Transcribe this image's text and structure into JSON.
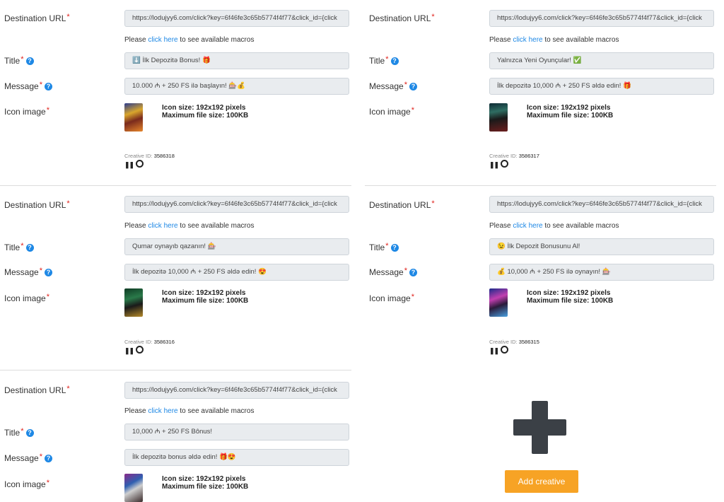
{
  "labels": {
    "destination_url": "Destination URL",
    "title": "Title",
    "message": "Message",
    "icon_image": "Icon image",
    "required_mark": "*",
    "help_glyph": "?"
  },
  "macros_hint": {
    "prefix": "Please",
    "link": "click here",
    "suffix": "to see available macros"
  },
  "icon_info": {
    "size": "Icon size: 192x192 pixels",
    "max": "Maximum file size: 100KB"
  },
  "creative_id_label": "Creative ID:",
  "creatives": [
    {
      "url": "https://lodujyy6.com/click?key=6f46fe3c65b5774f4f77&click_id={click",
      "title": "⬇️ İlk Depozitə Bonus! 🎁",
      "message": "10.000 ₼ + 250 FS ilə başlayın! 🎰💰",
      "creative_id": "3586318"
    },
    {
      "url": "https://lodujyy6.com/click?key=6f46fe3c65b5774f4f77&click_id={click",
      "title": "Yalnızca Yeni Oyunçular! ✅",
      "message": "İlk depozitə 10,000 ₼ + 250 FS əldə edin! 🎁",
      "creative_id": "3586317"
    },
    {
      "url": "https://lodujyy6.com/click?key=6f46fe3c65b5774f4f77&click_id={click",
      "title": "Qumar oynayıb qazanın! 🎰",
      "message": "İlk depozitə 10,000 ₼ + 250 FS əldə edin! 😍",
      "creative_id": "3586316"
    },
    {
      "url": "https://lodujyy6.com/click?key=6f46fe3c65b5774f4f77&click_id={click",
      "title": "😉 İlk Depozit Bonusunu Al!",
      "message": "💰 10,000 ₼ + 250 FS ilə oynayın! 🎰",
      "creative_id": "3586315"
    },
    {
      "url": "https://lodujyy6.com/click?key=6f46fe3c65b5774f4f77&click_id={click",
      "title": "10,000 ₼ + 250 FS Bônus!",
      "message": "İlk depozitə bonus əldə edin! 🎁😍",
      "creative_id": ""
    }
  ],
  "add_creative": {
    "label": "Add creative",
    "icon": "plus-icon"
  },
  "colors": {
    "accent_orange": "#f7a325",
    "link_blue": "#1e88e5",
    "required_red": "#e0211b",
    "field_bg": "#e9ecef",
    "plus_dark": "#3b4046"
  }
}
